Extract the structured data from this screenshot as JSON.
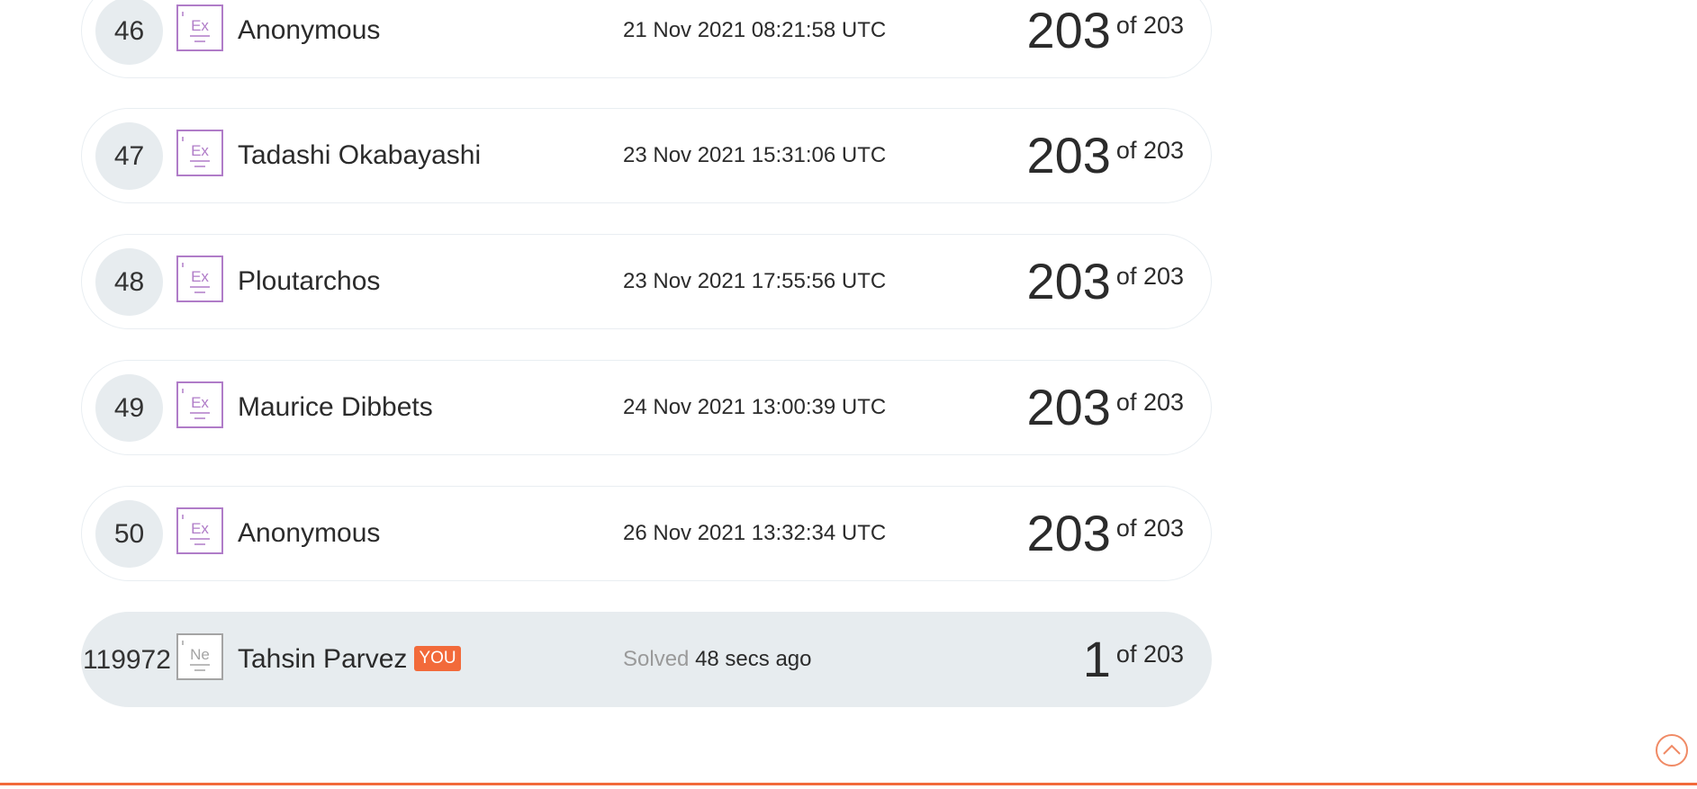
{
  "leaderboard": {
    "rows": [
      {
        "rank": "46",
        "badge": "Ex",
        "name": "Anonymous",
        "time": "21 Nov 2021 08:21:58 UTC",
        "score": "203",
        "total": "of 203"
      },
      {
        "rank": "47",
        "badge": "Ex",
        "name": "Tadashi Okabayashi",
        "time": "23 Nov 2021 15:31:06 UTC",
        "score": "203",
        "total": "of 203"
      },
      {
        "rank": "48",
        "badge": "Ex",
        "name": "Ploutarchos",
        "time": "23 Nov 2021 17:55:56 UTC",
        "score": "203",
        "total": "of 203"
      },
      {
        "rank": "49",
        "badge": "Ex",
        "name": "Maurice Dibbets",
        "time": "24 Nov 2021 13:00:39 UTC",
        "score": "203",
        "total": "of 203"
      },
      {
        "rank": "50",
        "badge": "Ex",
        "name": "Anonymous",
        "time": "26 Nov 2021 13:32:34 UTC",
        "score": "203",
        "total": "of 203"
      }
    ],
    "current_user": {
      "rank": "119972",
      "badge": "Ne",
      "name": "Tahsin Parvez",
      "you_label": "YOU",
      "solved_label": "Solved",
      "time": "48 secs ago",
      "score": "1",
      "total": "of 203"
    }
  },
  "colors": {
    "accent": "#f26a3a",
    "badge_expert": "#b07cc8",
    "badge_newbie": "#a4a4a4",
    "row_highlight": "#e7ecef"
  },
  "icons": {
    "scroll_top": "chevron-up-circle-icon"
  }
}
